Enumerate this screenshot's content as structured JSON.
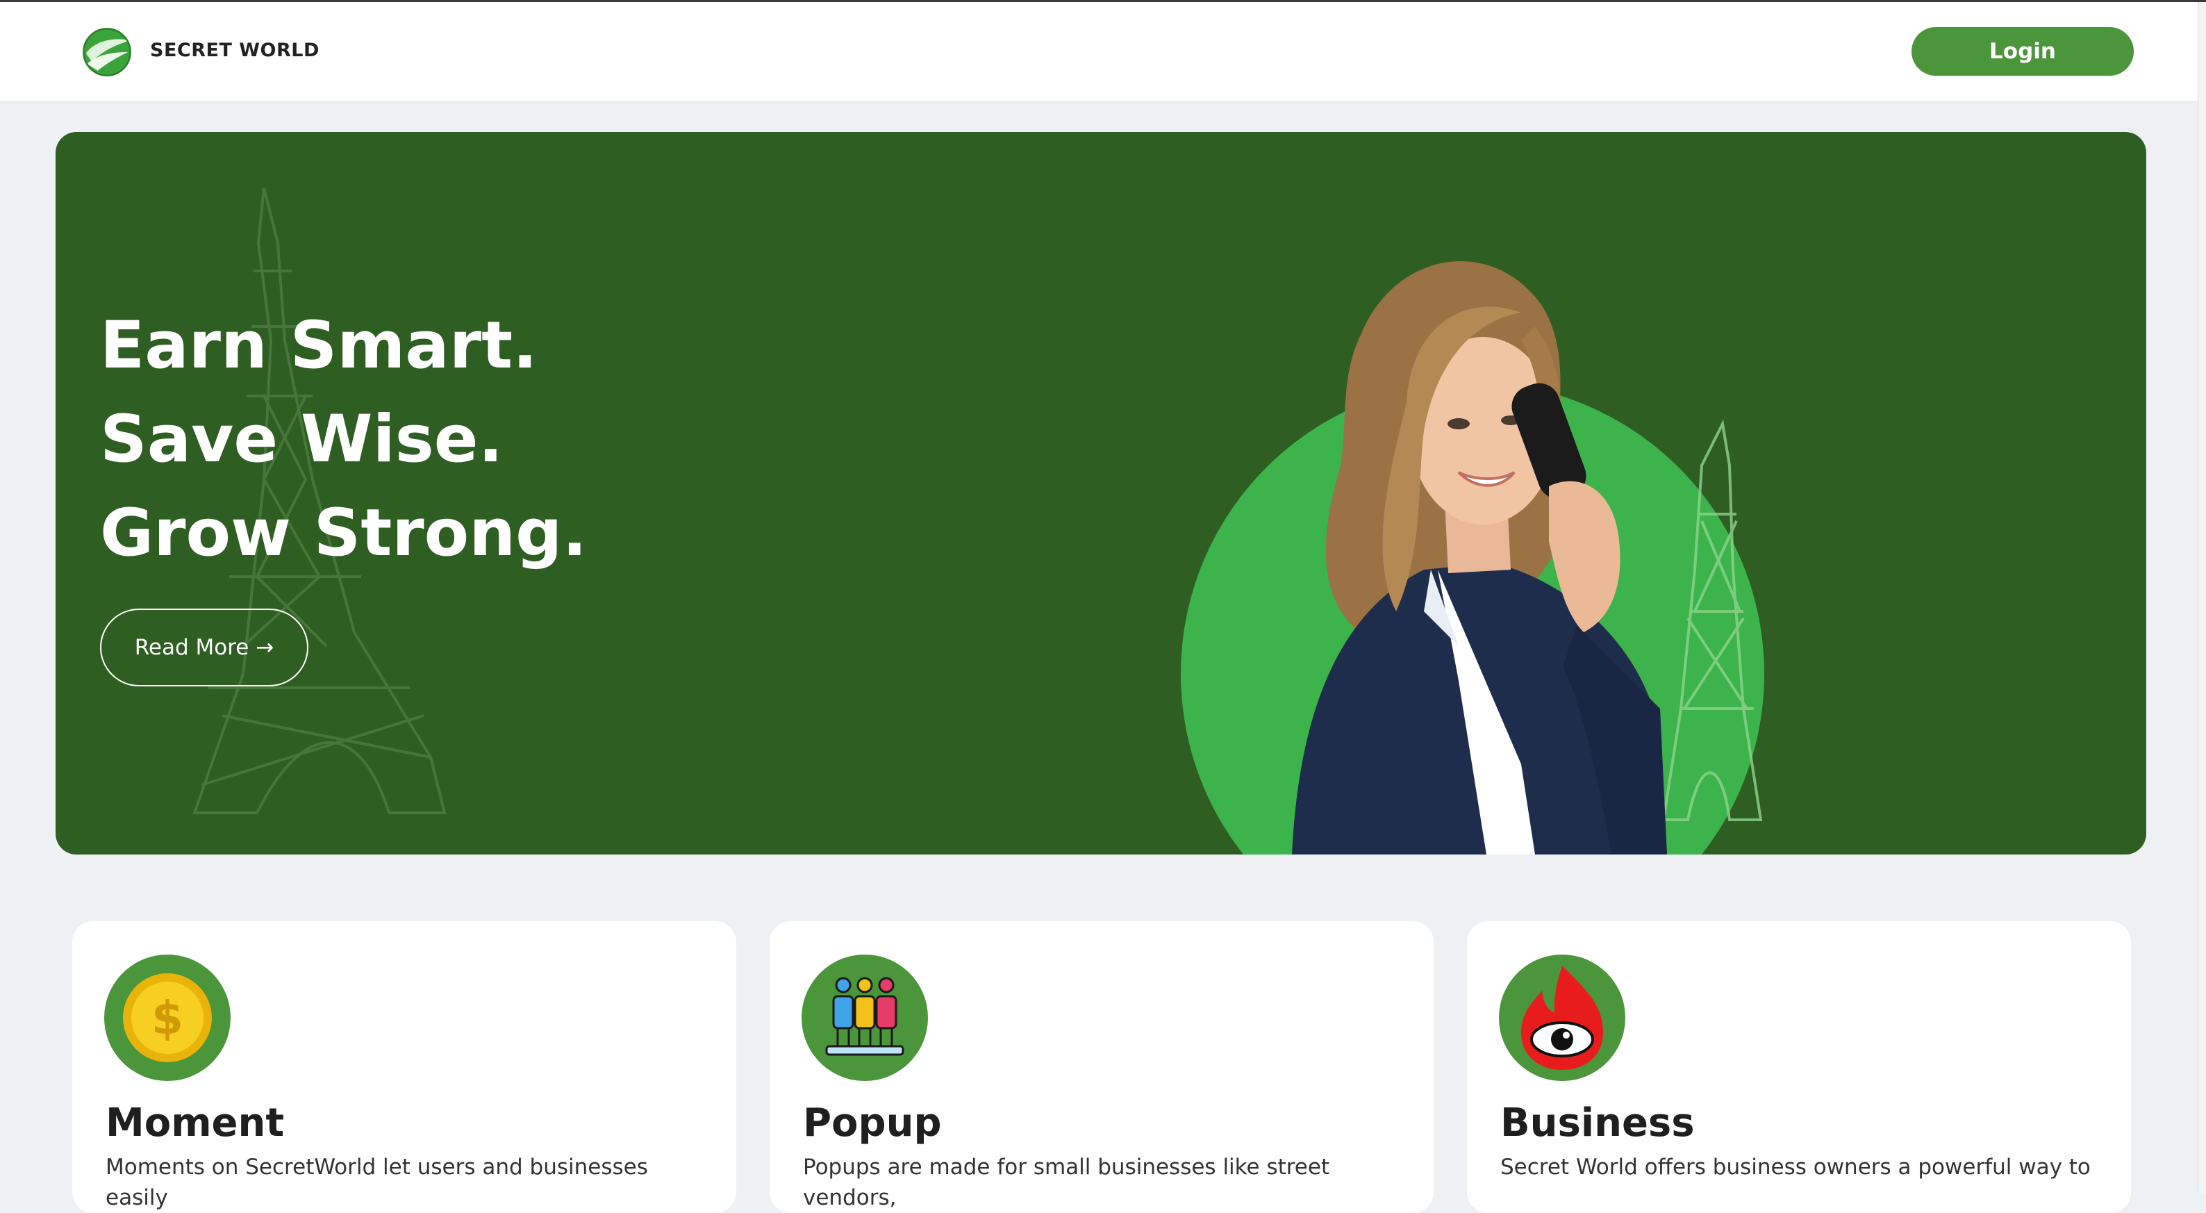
{
  "header": {
    "brand": "SECRET WORLD",
    "login_label": "Login"
  },
  "hero": {
    "lines": [
      "Earn Smart.",
      "Save Wise.",
      "Grow Strong."
    ],
    "read_more_label": "Read More →"
  },
  "cards": [
    {
      "title": "Moment",
      "description": "Moments on SecretWorld let users and businesses easily",
      "icon": "coin-icon"
    },
    {
      "title": "Popup",
      "description": "Popups are made for small businesses like street vendors,",
      "icon": "people-icon"
    },
    {
      "title": "Business",
      "description": "Secret World offers business owners a powerful way to",
      "icon": "fire-eye-icon"
    }
  ],
  "colors": {
    "brand_green": "#4b953b",
    "hero_bg": "#2e5e22",
    "accent_green": "#3cb44b",
    "page_bg": "#eef0f4"
  }
}
